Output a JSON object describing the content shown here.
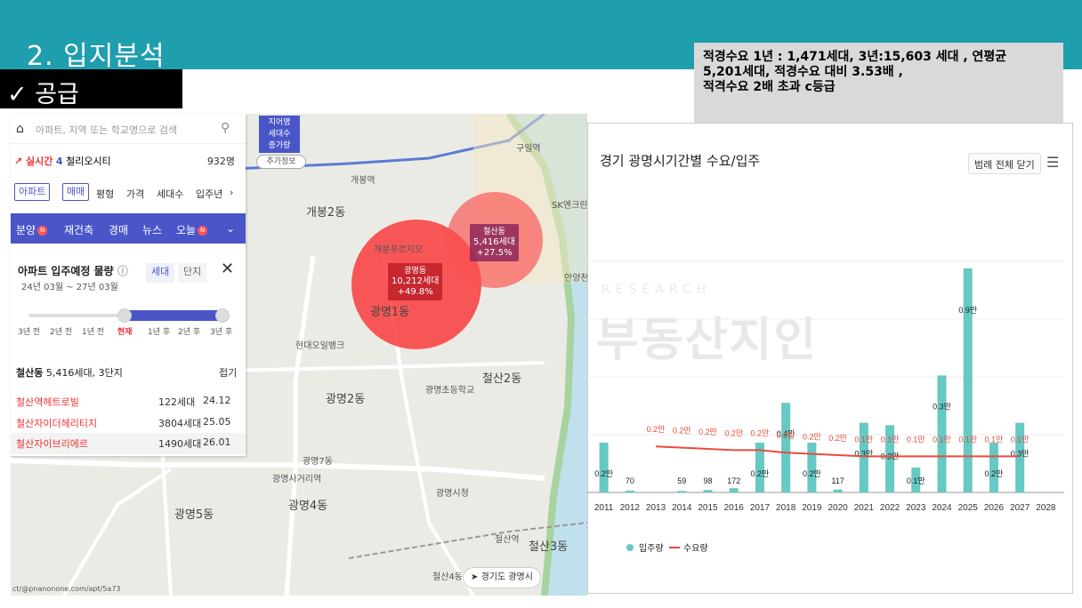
{
  "slide": {
    "title": "2. 입지분석",
    "supply_tag": "✓ 공급"
  },
  "note": "적경수요 1년 : 1,471세대, 3년:15,603 세대 , 연평균\n5,201세대, 적경수요 대비 3.53배 ,\n적격수요 2배 초과 c등급",
  "sidebar": {
    "search_placeholder": "아파트, 지역 또는 학교명으로 검색",
    "trend_label": "실시간",
    "trend_rank": "4",
    "trend_name": "철리오시티",
    "trend_count": "932명",
    "filters": [
      "아파트",
      "매매",
      "평형",
      "가격",
      "세대수",
      "입주년"
    ],
    "tabs": [
      "분양",
      "재건축",
      "경매",
      "뉴스",
      "오늘"
    ],
    "panel_title": "아파트 입주예정 물량",
    "panel_period": "24년 03월 ~ 27년 03월",
    "seg": [
      "세대",
      "단지"
    ],
    "ticks": [
      "3년 전",
      "2년 전",
      "1년 전",
      "현재",
      "1년 후",
      "2년 후",
      "3년 후"
    ],
    "section_title": "철산동",
    "section_sub": "5,416세대, 3단지",
    "section_fold": "접기",
    "rows": [
      {
        "name": "철산역헤트로빌",
        "hh": "122세대",
        "date": "24.12"
      },
      {
        "name": "철산자이더헤리티지",
        "hh": "3804세대",
        "date": "25.05"
      },
      {
        "name": "철산자이브리에르",
        "hh": "1490세대",
        "date": "26.01"
      }
    ]
  },
  "map": {
    "top_tag_1": "지어명",
    "top_tag_2": "세대수",
    "top_tag_3": "증가량",
    "add_info": "추가정보",
    "clusters": [
      {
        "name": "광명동",
        "households": "10,212세대",
        "growth": "+49.8%"
      },
      {
        "name": "철산동",
        "households": "5,416세대",
        "growth": "+27.5%"
      }
    ],
    "labels": [
      "개봉2동",
      "개봉역",
      "광명2동",
      "광명1동",
      "철산2동",
      "광명사거리역",
      "광명4동",
      "광명5동",
      "철산3동",
      "철산역",
      "구일역",
      "개봉푸르지오",
      "광명초등학교",
      "광명시청",
      "현대오일뱅크",
      "SK엔크린",
      "안양천",
      "광명7동",
      "철산4동"
    ],
    "region_button": "경기도 광명시",
    "footer": "ct/@pnanonone.com/apt/5a73"
  },
  "chart_data": {
    "type": "bar",
    "title": "경기 광명시기간별 수요/입주",
    "legend_close": "범례 전체 닫기",
    "categories": [
      "2011",
      "2012",
      "2013",
      "2014",
      "2015",
      "2016",
      "2017",
      "2018",
      "2019",
      "2020",
      "2021",
      "2022",
      "2023",
      "2024",
      "2025",
      "2026",
      "2027",
      "2028"
    ],
    "series": [
      {
        "name": "입주량",
        "color": "#66c9c3",
        "values": [
          2000,
          70,
          0,
          59,
          98,
          172,
          2000,
          3600,
          2000,
          117,
          2800,
          2700,
          1000,
          4700,
          9000,
          2000,
          2800,
          0
        ],
        "labels": [
          "0.2만",
          "70",
          "",
          "59",
          "98",
          "172",
          "0.2만",
          "0.4만",
          "0.2만",
          "117",
          "0.3만",
          "0.3만",
          "0.1만",
          "0.3만",
          "0.9만",
          "0.2만",
          "0.3만",
          ""
        ]
      },
      {
        "name": "수요량",
        "color": "#e84c3d",
        "values": [
          null,
          null,
          1850,
          1800,
          1750,
          1700,
          1700,
          1600,
          1550,
          1500,
          1450,
          1450,
          1450,
          1450,
          1450,
          1450,
          1450,
          null
        ],
        "labels": [
          "",
          "",
          "0.2만",
          "0.2만",
          "0.2만",
          "0.2만",
          "0.2만",
          "0.2만",
          "0.2만",
          "0.2만",
          "0.1만",
          "0.1만",
          "0.1만",
          "0.1만",
          "0.1만",
          "0.1만",
          "0.1만",
          ""
        ]
      }
    ],
    "ylim": [
      0,
      12000
    ]
  },
  "watermark": {
    "sub": "RESEARCH",
    "main": "부동산지인"
  }
}
